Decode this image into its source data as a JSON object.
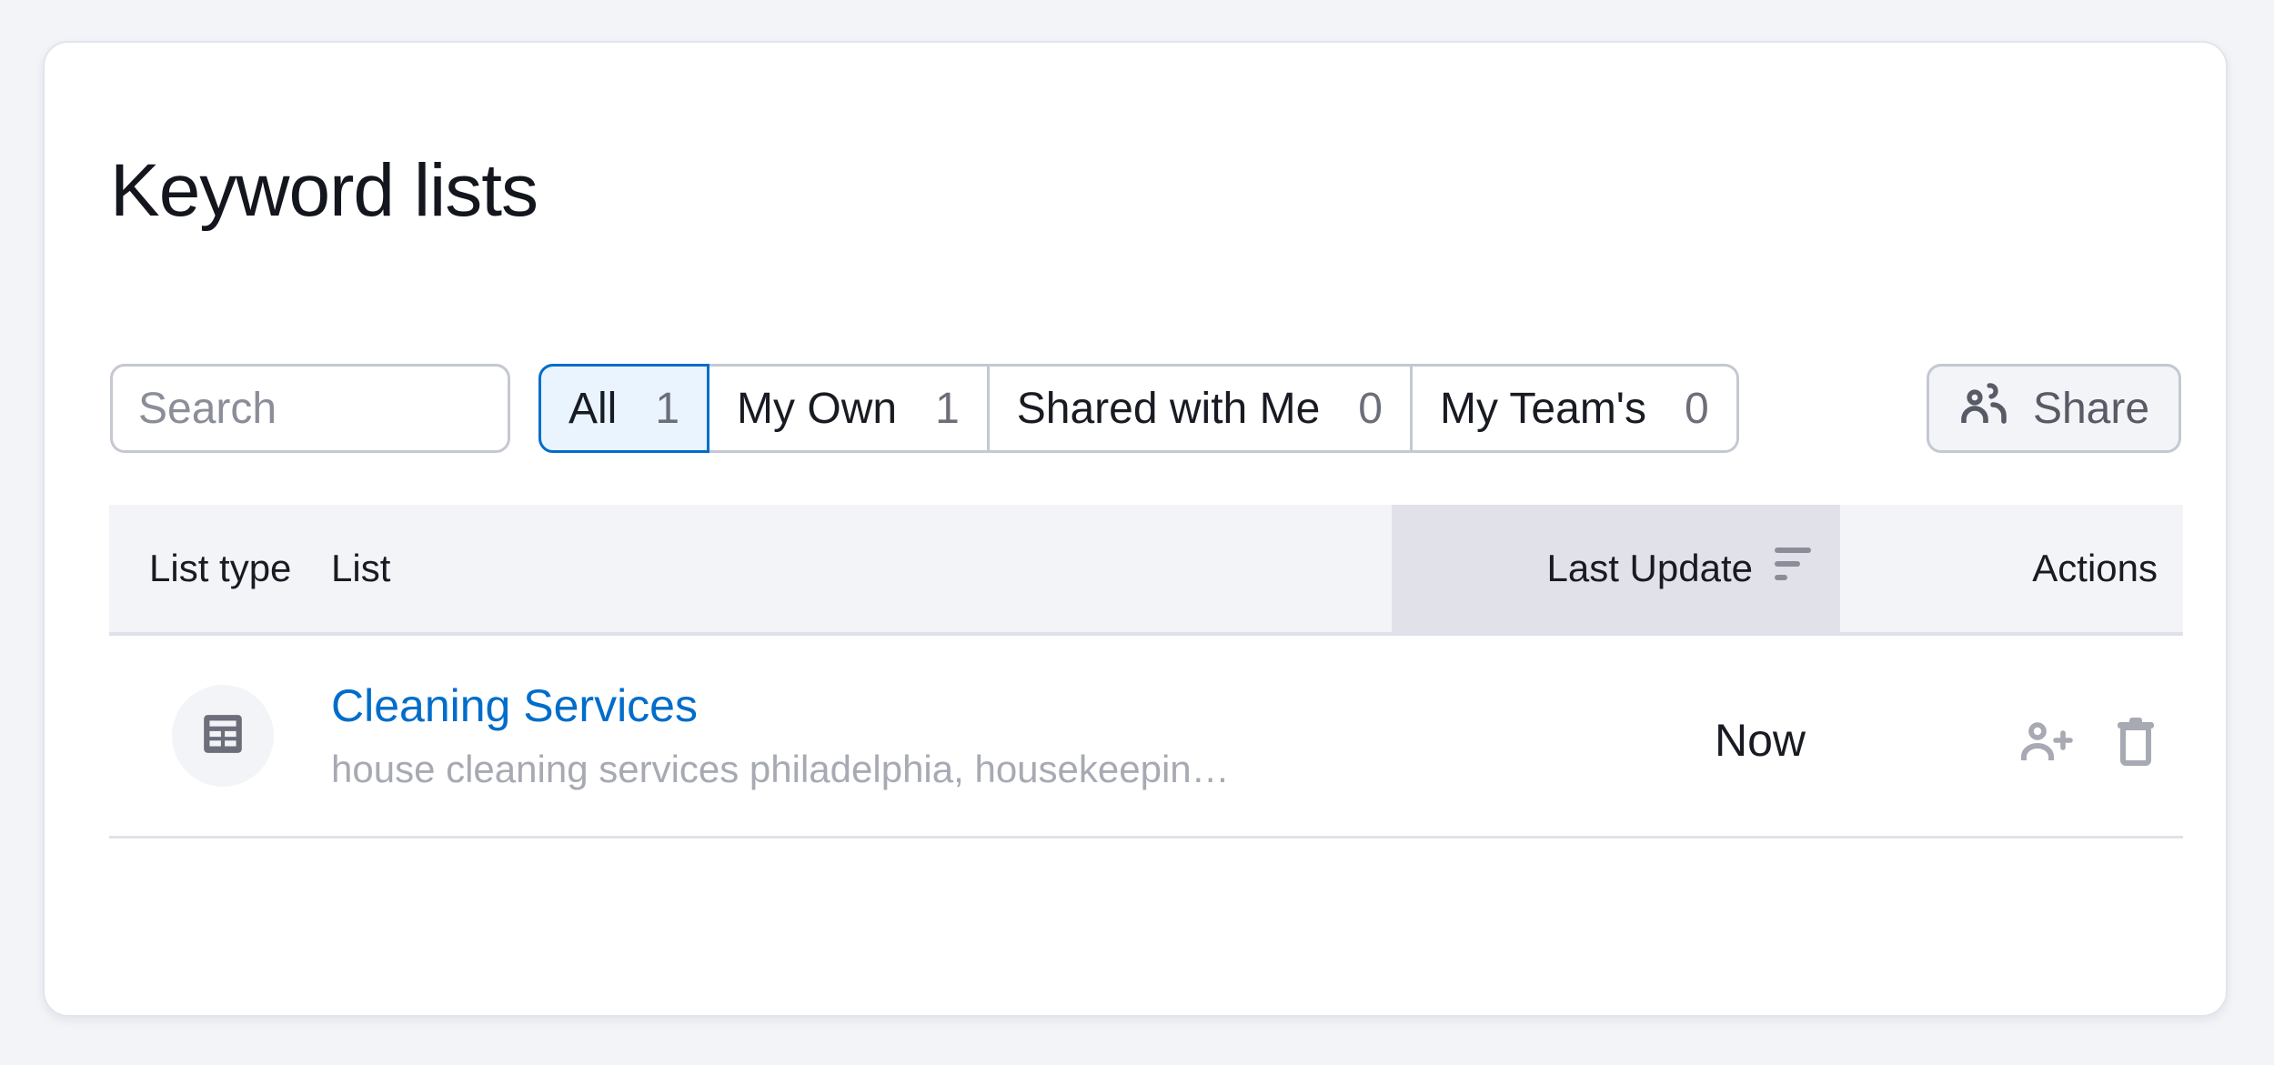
{
  "page": {
    "title": "Keyword lists"
  },
  "search": {
    "placeholder": "Search",
    "value": "",
    "button_icon": "search-icon"
  },
  "filters": {
    "tabs": [
      {
        "label": "All",
        "count": "1",
        "active": true
      },
      {
        "label": "My Own",
        "count": "1",
        "active": false
      },
      {
        "label": "Shared with Me",
        "count": "0",
        "active": false
      },
      {
        "label": "My Team's",
        "count": "0",
        "active": false
      }
    ]
  },
  "share_button": {
    "label": "Share",
    "icon": "users-icon"
  },
  "table": {
    "columns": {
      "list_type": "List type",
      "list": "List",
      "last_update": "Last Update",
      "actions": "Actions"
    },
    "sort": {
      "column": "last_update",
      "icon": "sort-icon"
    },
    "rows": [
      {
        "type_icon": "table-icon",
        "name": "Cleaning Services",
        "keywords": "house cleaning services philadelphia, housekeeping services philadelphia",
        "last_update": "Now",
        "actions": [
          "share-user-icon",
          "trash-icon"
        ]
      }
    ]
  },
  "colors": {
    "accent": "#006dca",
    "active_tab_bg": "#e9f4ff",
    "page_bg": "#f3f4f8",
    "muted_text": "#a7a9b3",
    "icon_gray": "#a7a9b3"
  }
}
